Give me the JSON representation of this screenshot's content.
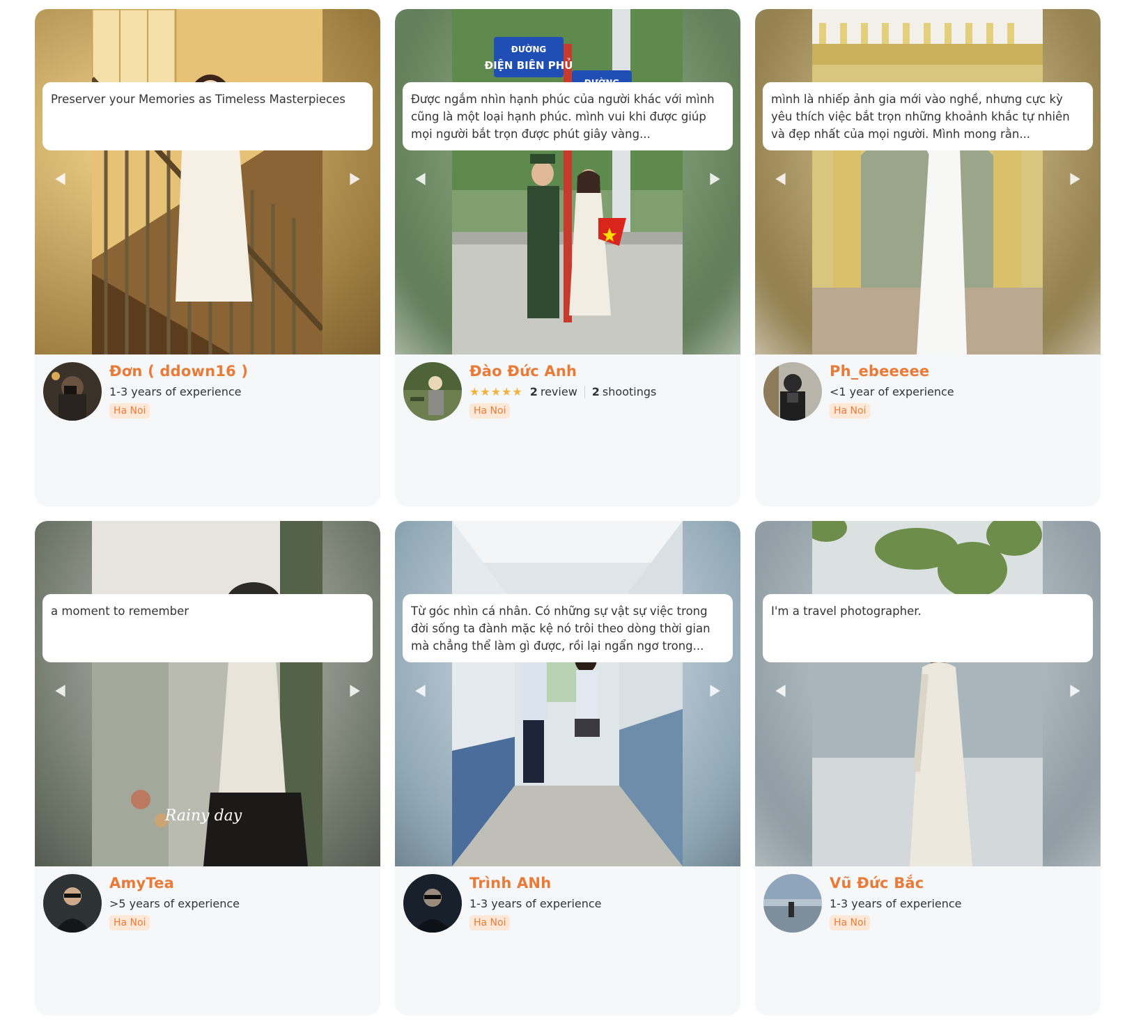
{
  "cards": [
    {
      "name": "Đơn ( ddown16 )",
      "experience": "1-3 years of experience",
      "location": "Ha Noi",
      "description": "Preserver your Memories as Timeless Masterpieces",
      "colors": {
        "bg": "#c9a55c",
        "photo": "#e9c26e"
      }
    },
    {
      "name": "Đào Đức Anh",
      "stars": "★★★★★",
      "reviews_count": "2",
      "reviews_label": "review",
      "shootings_count": "2",
      "shootings_label": "shootings",
      "location": "Ha Noi",
      "description": "Được ngắm nhìn hạnh phúc của người khác với mình cũng là một loại hạnh phúc. mình vui khi được giúp mọi người bắt trọn được phút giây vàng...",
      "colors": {
        "bg": "#7c9a72",
        "photo": "#8fb27d"
      }
    },
    {
      "name": "Ph_ebeeeee",
      "experience": "<1 year of experience",
      "location": "Ha Noi",
      "description": "mình là nhiếp ảnh gia mới vào nghề, nhưng cực kỳ yêu thích việc bắt trọn những khoảnh khắc tự nhiên và đẹp nhất của mọi người. Mình mong rằn...",
      "colors": {
        "bg": "#b8a574",
        "photo": "#d2bc6e"
      }
    },
    {
      "name": "AmyTea",
      "experience": ">5 years of experience",
      "location": "Ha Noi",
      "description": "a moment to remember",
      "watermark": "Rainy day",
      "colors": {
        "bg": "#8c9388",
        "photo": "#a8aca0"
      }
    },
    {
      "name": "Trình ANh",
      "experience": "1-3 years of experience",
      "location": "Ha Noi",
      "description": "Từ góc nhìn cá nhân. Có những sự vật sự việc trong đời sống ta đành mặc kệ nó trôi theo dòng thời gian mà chẳng thể làm gì được, rồi lại ngẩn ngơ trong...",
      "colors": {
        "bg": "#8ea6b4",
        "photo": "#c7d4db"
      }
    },
    {
      "name": "Vũ Đức Bắc",
      "experience": "1-3 years of experience",
      "location": "Ha Noi",
      "description": "I'm a travel photographer.",
      "colors": {
        "bg": "#98a6ac",
        "photo": "#bcc6cb"
      }
    }
  ],
  "icons": {
    "prev": "chevron-left-icon",
    "next": "chevron-right-icon"
  },
  "accent": "#e97a37"
}
